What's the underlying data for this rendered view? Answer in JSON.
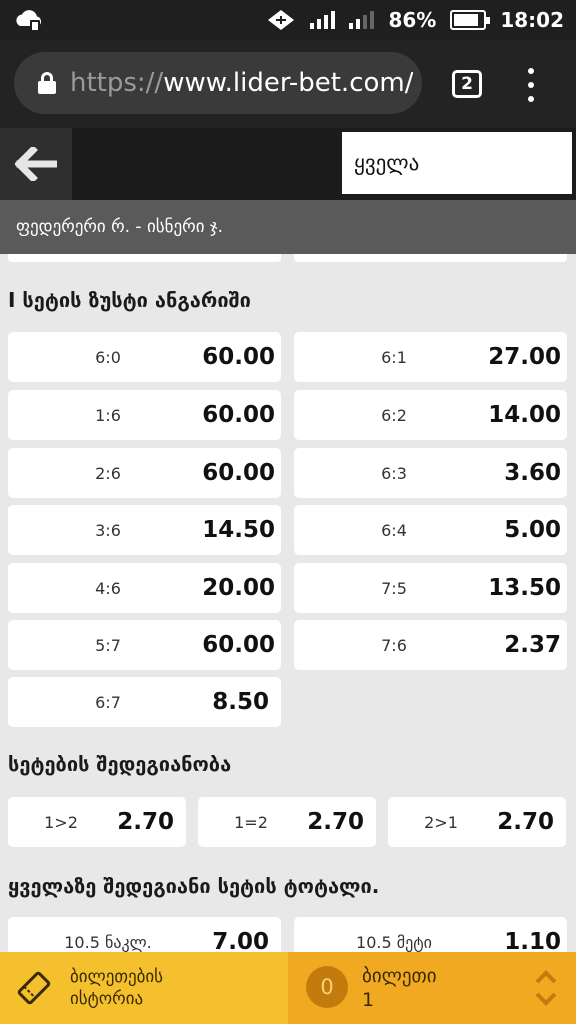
{
  "status_bar": {
    "battery": "86%",
    "time": "18:02"
  },
  "browser": {
    "url_scheme": "https://",
    "url_host": "www.lider-bet.com/",
    "tab_count": "2"
  },
  "header": {
    "filter_value": "ყველა",
    "match_title": "ფედერერი რ. - ისნერი ჯ."
  },
  "sections": {
    "exact_score": {
      "title": "I სეტის ზუსტი ანგარიში",
      "cells": [
        {
          "label": "6:0",
          "odd": "60.00"
        },
        {
          "label": "6:1",
          "odd": "27.00"
        },
        {
          "label": "1:6",
          "odd": "60.00"
        },
        {
          "label": "6:2",
          "odd": "14.00"
        },
        {
          "label": "2:6",
          "odd": "60.00"
        },
        {
          "label": "6:3",
          "odd": "3.60"
        },
        {
          "label": "3:6",
          "odd": "14.50"
        },
        {
          "label": "6:4",
          "odd": "5.00"
        },
        {
          "label": "4:6",
          "odd": "20.00"
        },
        {
          "label": "7:5",
          "odd": "13.50"
        },
        {
          "label": "5:7",
          "odd": "60.00"
        },
        {
          "label": "7:6",
          "odd": "2.37"
        },
        {
          "label": "6:7",
          "odd": "8.50"
        }
      ]
    },
    "set_result": {
      "title": "სეტების შედეგიანობა",
      "cells": [
        {
          "label": "1>2",
          "odd": "2.70"
        },
        {
          "label": "1=2",
          "odd": "2.70"
        },
        {
          "label": "2>1",
          "odd": "2.70"
        }
      ]
    },
    "best_set_total": {
      "title": "ყველაზე შედეგიანი სეტის ტოტალი.",
      "cells": [
        {
          "label": "10.5 ნაკლ.",
          "odd": "7.00"
        },
        {
          "label": "10.5 მეტი",
          "odd": "1.10"
        }
      ]
    }
  },
  "bottom_bar": {
    "history_line1": "ბილეთების",
    "history_line2": "ისტორია",
    "ticket_count": "0",
    "ticket_label": "ბილეთი",
    "ticket_sub": "1"
  },
  "colors": {
    "history_bg": "#f5c02d",
    "ticket_bg": "#f2a922",
    "header_bg": "#1c1c1c",
    "match_bar_bg": "#5a5a5a"
  }
}
